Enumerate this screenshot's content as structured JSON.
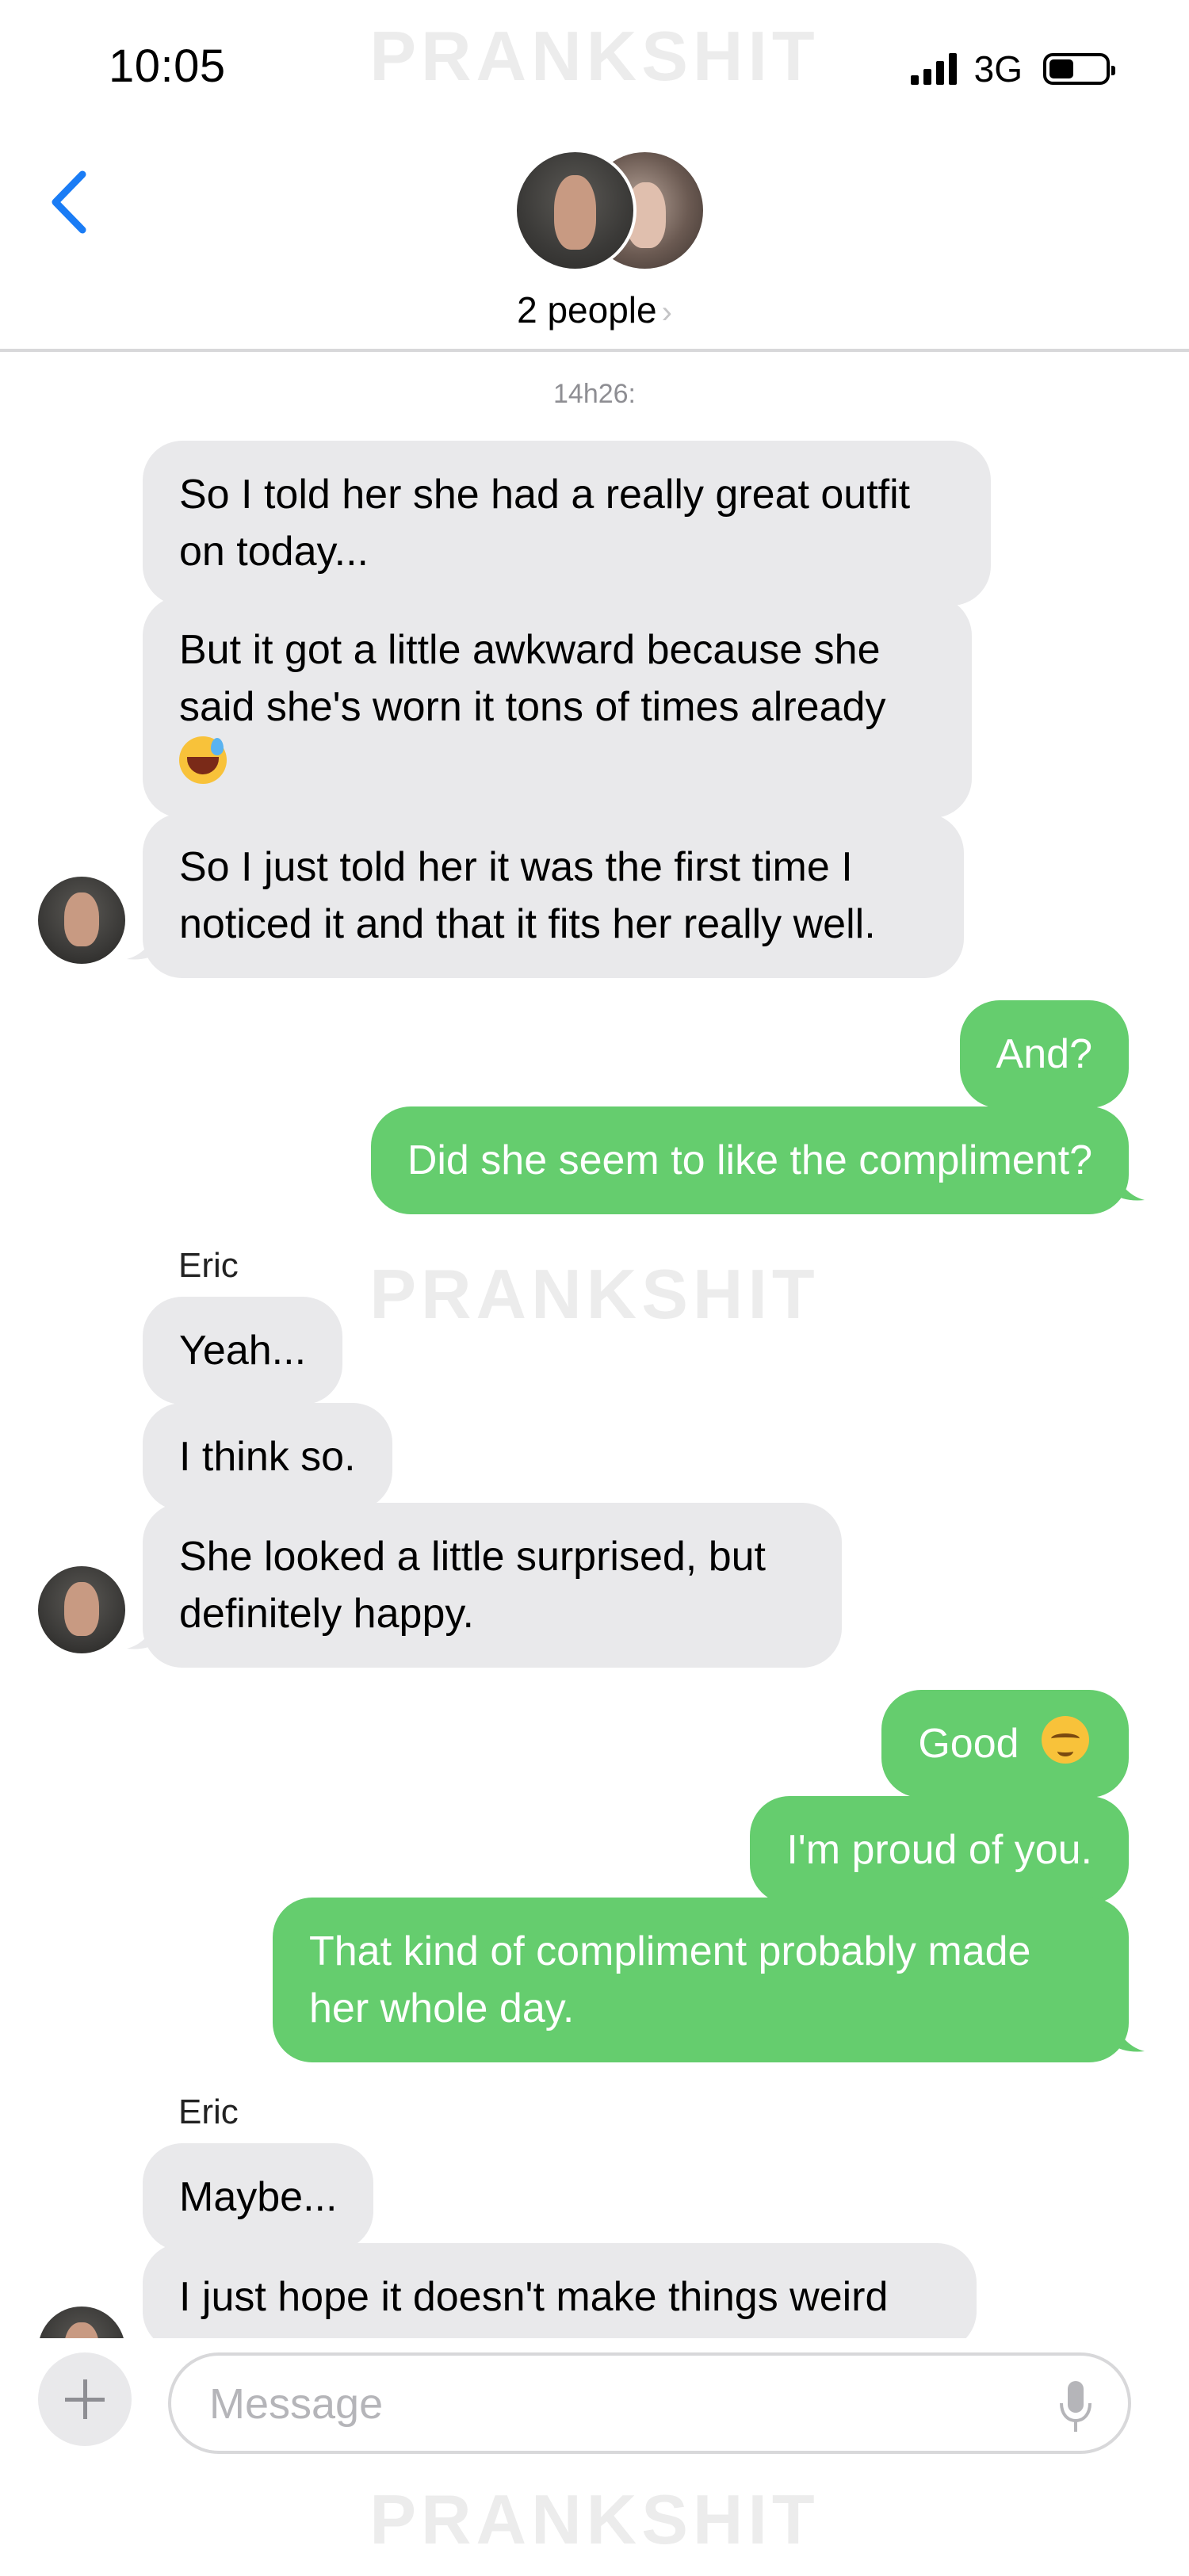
{
  "status_bar": {
    "time": "10:05",
    "network": "3G"
  },
  "watermark": "PRANKSHIT",
  "header": {
    "title": "2 people",
    "chevron": "›"
  },
  "timestamp": "14h26:",
  "messages": [
    {
      "side": "in",
      "text": "So I told her she had a really great outfit on today..."
    },
    {
      "side": "in",
      "text": "But it got a little awkward because she said she's worn it tons of times already",
      "emoji": "grinning-sweat-emoji"
    },
    {
      "side": "in",
      "text": "So I just told her it was the first time I noticed it and that it fits her really well."
    },
    {
      "side": "out",
      "text": "And?"
    },
    {
      "side": "out",
      "text": "Did she seem to like the compliment?"
    },
    {
      "sender": "Eric"
    },
    {
      "side": "in",
      "text": "Yeah..."
    },
    {
      "side": "in",
      "text": "I think so."
    },
    {
      "side": "in",
      "text": "She looked a little surprised, but definitely happy."
    },
    {
      "side": "out",
      "text": "Good",
      "emoji": "relieved-face-emoji"
    },
    {
      "side": "out",
      "text": "I'm proud of you."
    },
    {
      "side": "out",
      "text": "That kind of compliment probably made her whole day."
    },
    {
      "sender": "Eric"
    },
    {
      "side": "in",
      "text": "Maybe..."
    },
    {
      "side": "in",
      "text": "I just hope it doesn't make things weird"
    }
  ],
  "input": {
    "placeholder": "Message"
  },
  "colors": {
    "incoming": "#e9e9eb",
    "outgoing": "#65cd6e",
    "accent": "#1a7cf5"
  }
}
